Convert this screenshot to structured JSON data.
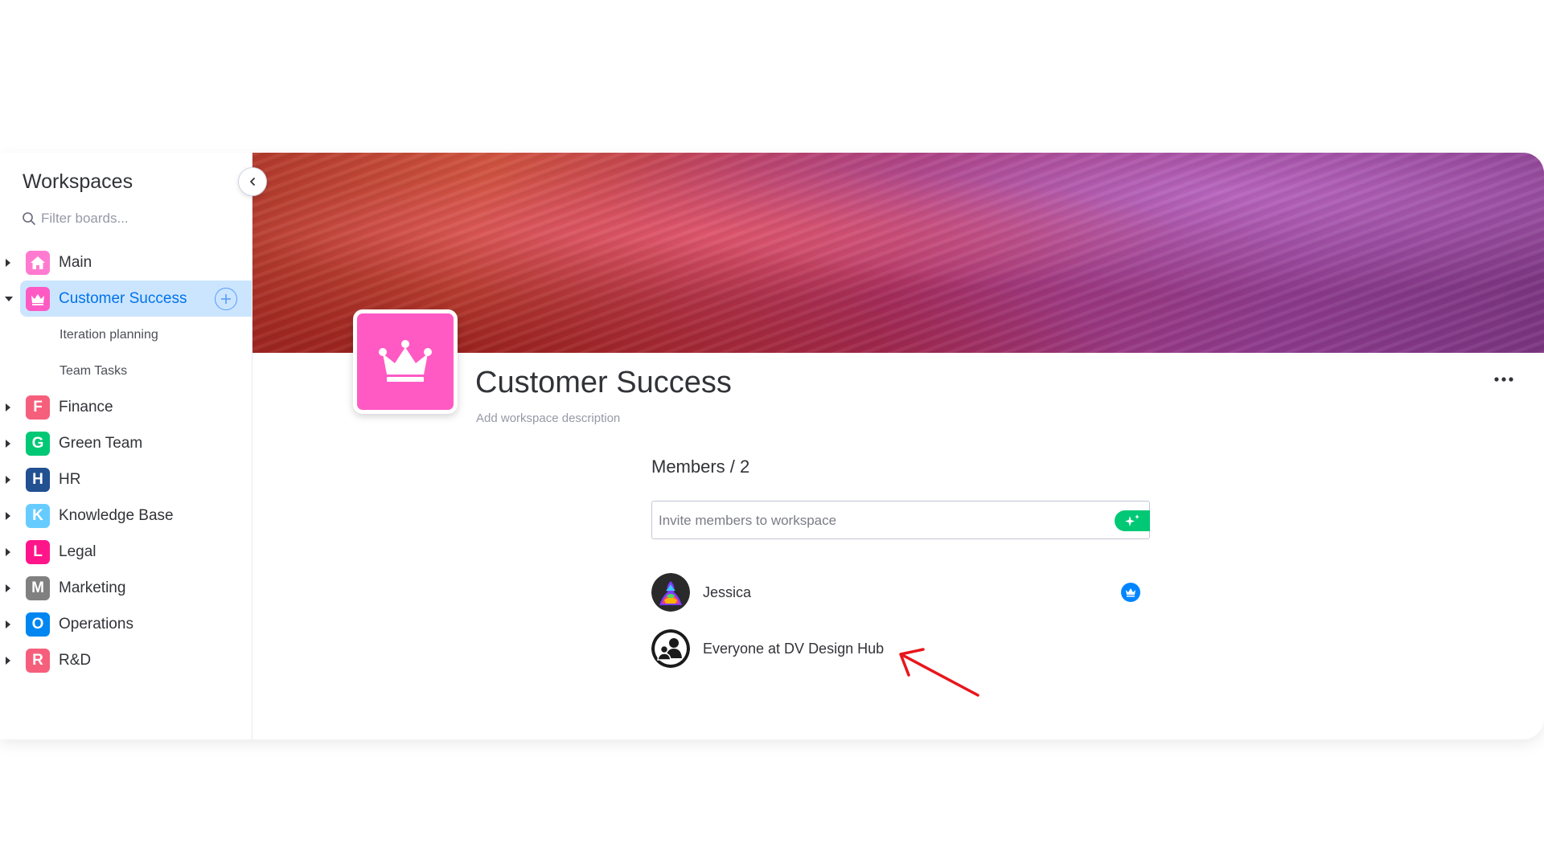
{
  "sidebar": {
    "title": "Workspaces",
    "filter_placeholder": "Filter boards...",
    "workspaces": [
      {
        "letter": "",
        "label": "Main",
        "color": "#ff7bd0",
        "icon": "home-icon"
      },
      {
        "letter": "",
        "label": "Customer Success",
        "color": "#ff5ac4",
        "icon": "crown-icon",
        "selected": true,
        "boards": [
          "Iteration planning",
          "Team Tasks"
        ]
      },
      {
        "letter": "F",
        "label": "Finance",
        "color": "#f65f7c"
      },
      {
        "letter": "G",
        "label": "Green Team",
        "color": "#00c875"
      },
      {
        "letter": "H",
        "label": "HR",
        "color": "#225091"
      },
      {
        "letter": "K",
        "label": "Knowledge Base",
        "color": "#66ccff"
      },
      {
        "letter": "L",
        "label": "Legal",
        "color": "#ff158a"
      },
      {
        "letter": "M",
        "label": "Marketing",
        "color": "#808080"
      },
      {
        "letter": "O",
        "label": "Operations",
        "color": "#0086f0"
      },
      {
        "letter": "R",
        "label": "R&D",
        "color": "#f65f7c"
      }
    ]
  },
  "workspace": {
    "title": "Customer Success",
    "description_placeholder": "Add workspace description",
    "icon": "crown-icon",
    "icon_color": "#ff5ac4"
  },
  "members": {
    "heading": "Members  / 2",
    "invite_placeholder": "Invite members to workspace",
    "list": [
      {
        "name": "Jessica",
        "owner": true
      },
      {
        "name": "Everyone at DV Design Hub",
        "owner": false
      }
    ]
  },
  "colors": {
    "accent": "#0073ea",
    "selected_bg": "#cce5ff",
    "invite_button": "#00c875",
    "annotation": "#e8161b"
  }
}
